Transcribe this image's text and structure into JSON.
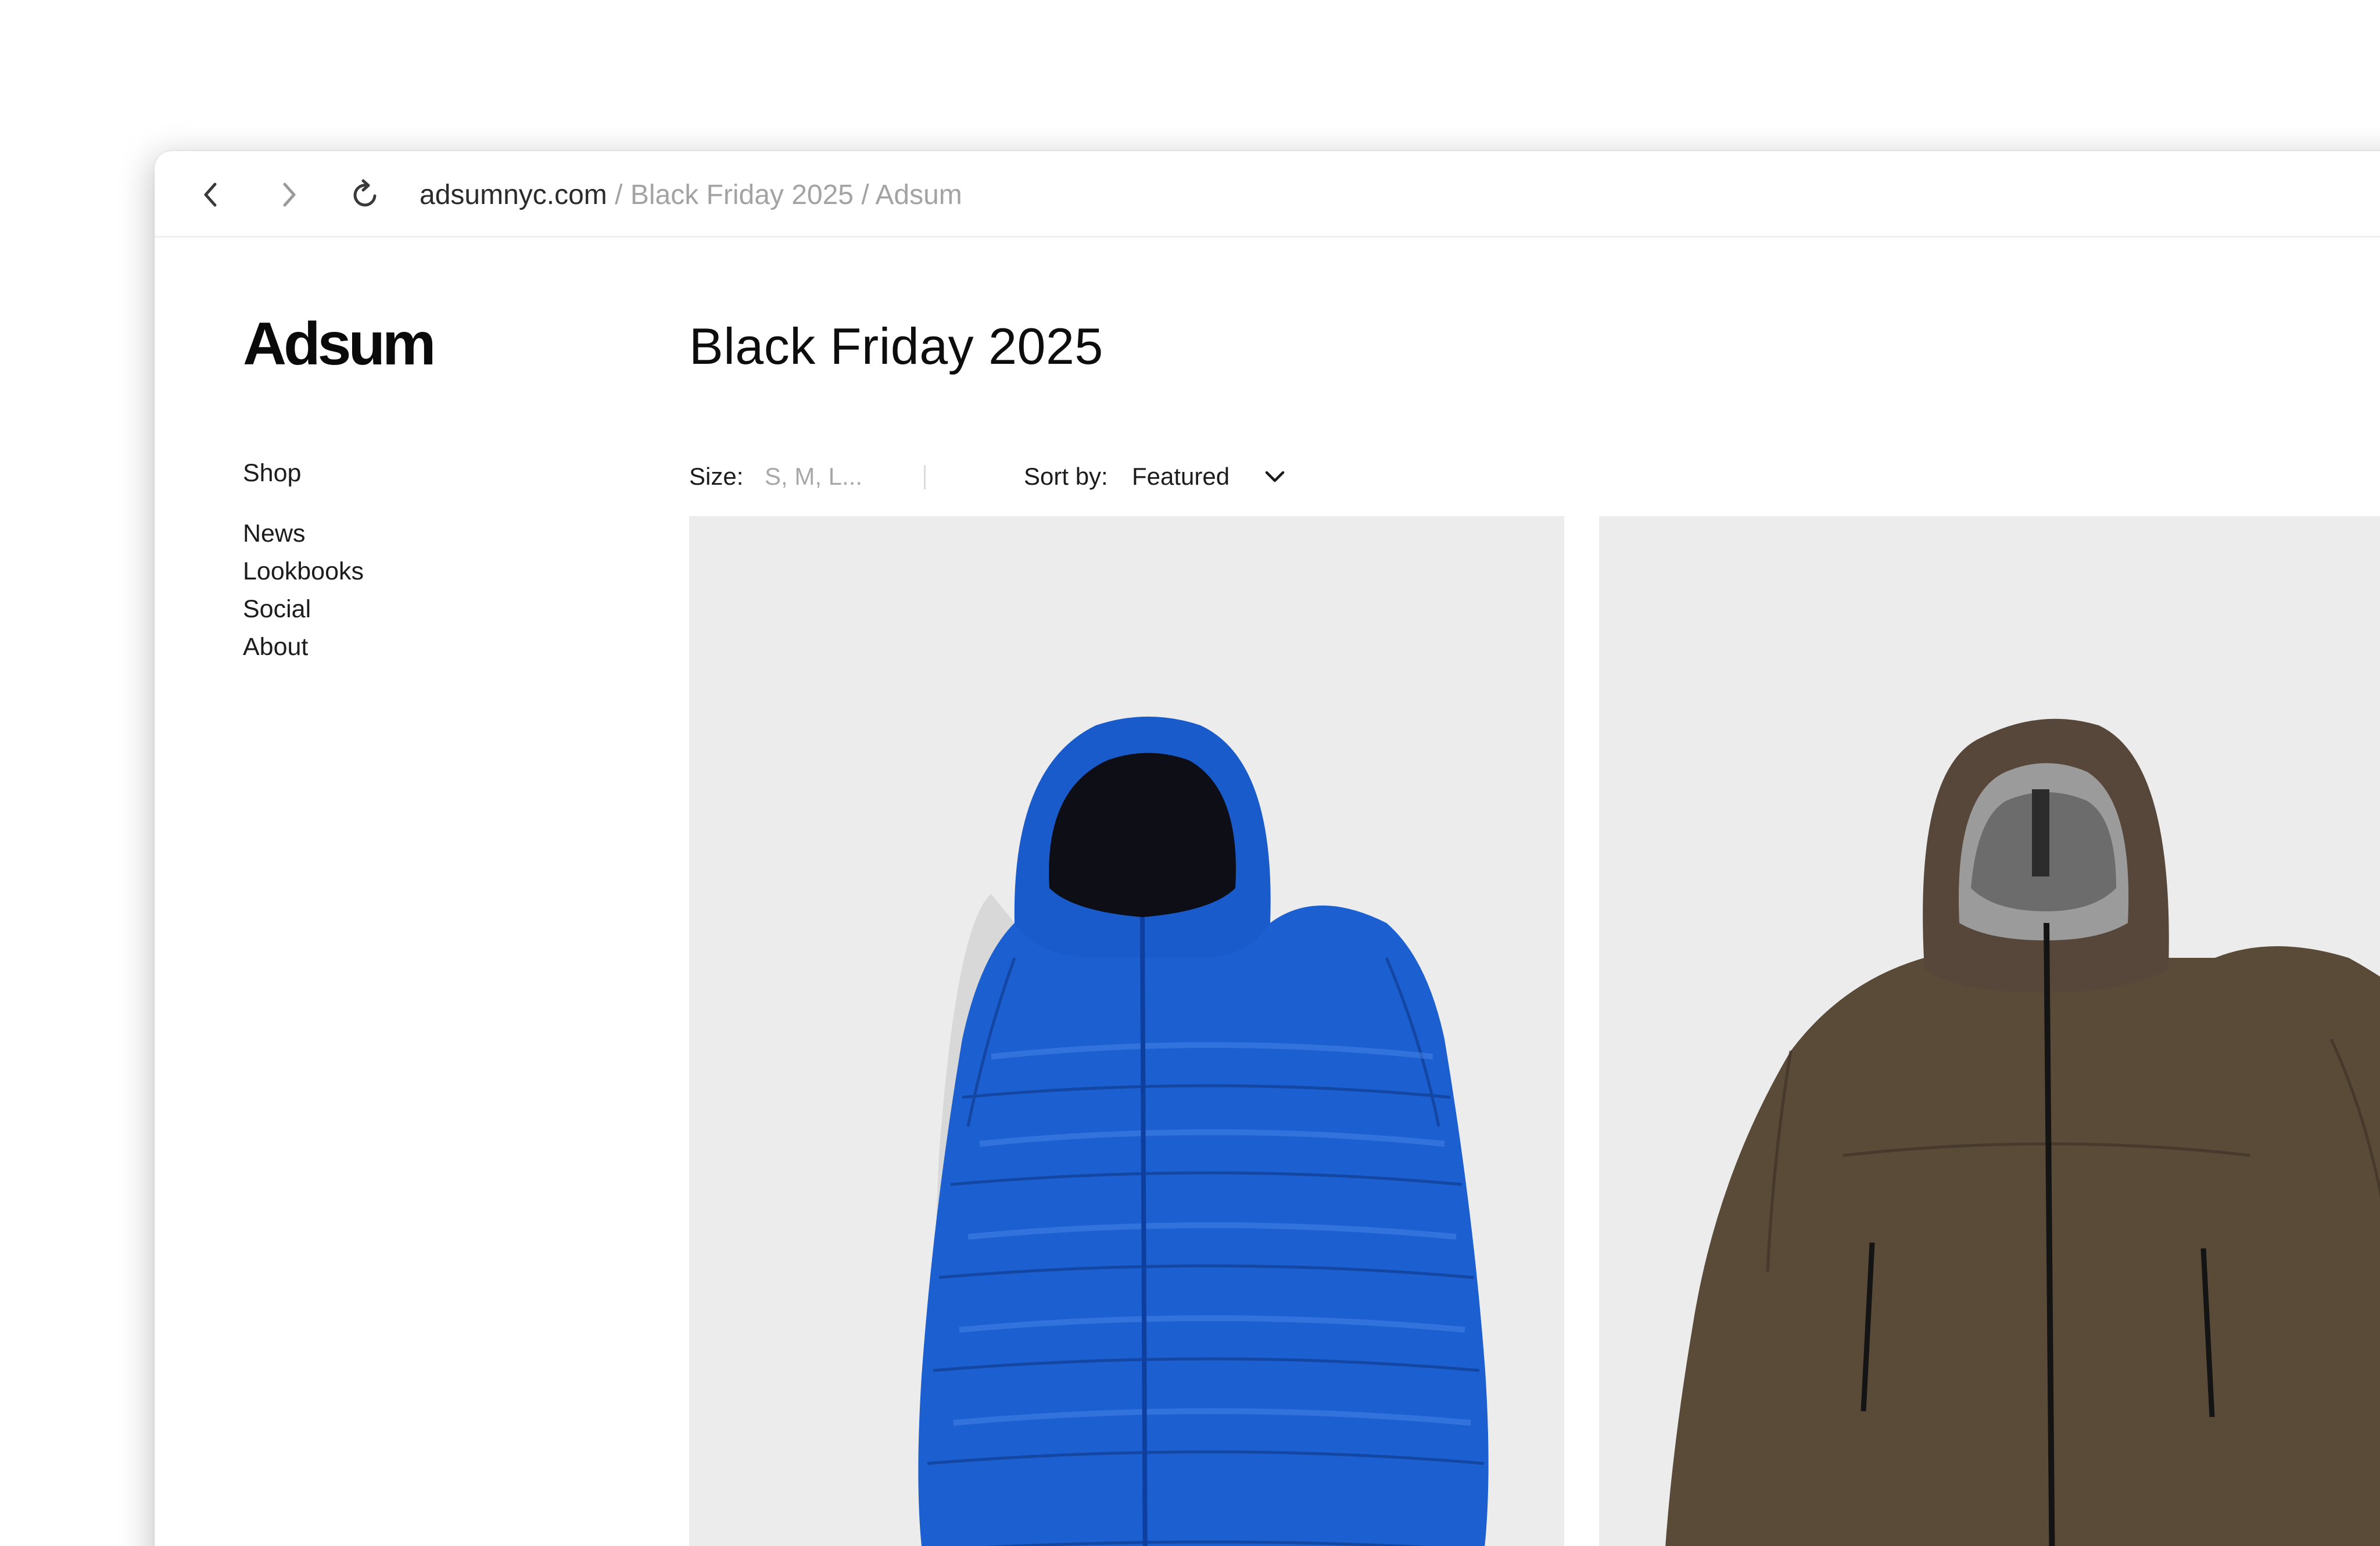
{
  "browser": {
    "back_icon": "chevron-left-icon",
    "forward_icon": "chevron-right-icon",
    "reload_icon": "reload-icon",
    "address": {
      "domain": "adsumnyc.com",
      "separator": "/",
      "segments": [
        "Black Friday 2025",
        "Adsum"
      ]
    }
  },
  "brand": {
    "logo": "Adsum"
  },
  "sidebar": {
    "items": [
      {
        "label": "Shop"
      },
      {
        "label": "News"
      },
      {
        "label": "Lookbooks"
      },
      {
        "label": "Social"
      },
      {
        "label": "About"
      }
    ]
  },
  "main": {
    "title": "Black Friday 2025",
    "filters": {
      "size_label": "Size:",
      "size_placeholder": "S, M, L...",
      "sort_label": "Sort by:",
      "sort_value": "Featured",
      "sort_icon": "chevron-down-icon"
    },
    "products": [
      {
        "image": "blue puffer jacket",
        "color": "#1b5fd0"
      },
      {
        "image": "olive shell jacket",
        "color": "#5a4a38"
      }
    ]
  },
  "colors": {
    "card_background": "#ececec",
    "text_primary": "#1c1c1c",
    "text_muted": "#a3a3a3"
  }
}
